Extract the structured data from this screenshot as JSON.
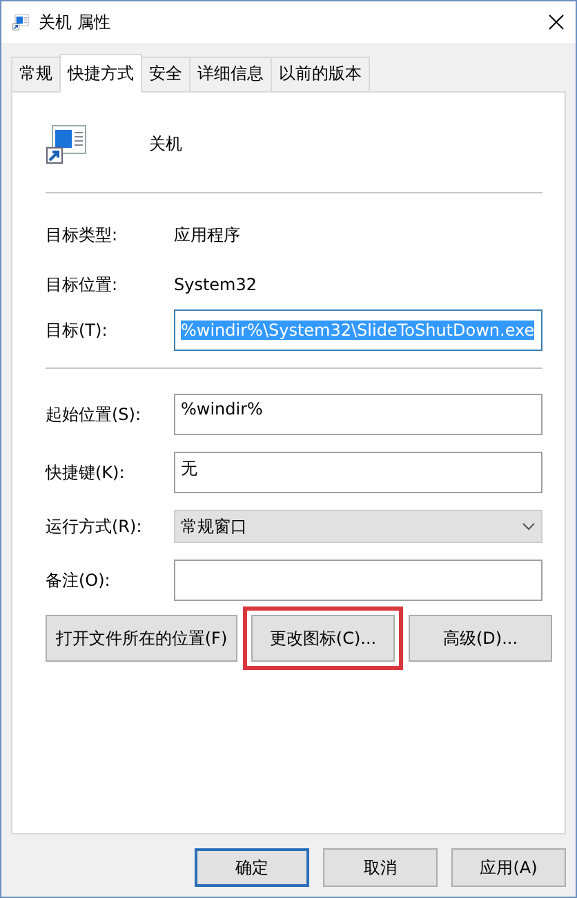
{
  "window": {
    "title": "关机 属性"
  },
  "tabs": [
    {
      "label": "常规",
      "selected": false
    },
    {
      "label": "快捷方式",
      "selected": true
    },
    {
      "label": "安全",
      "selected": false
    },
    {
      "label": "详细信息",
      "selected": false
    },
    {
      "label": "以前的版本",
      "selected": false
    }
  ],
  "shortcut": {
    "name": "关机"
  },
  "info": [
    {
      "label": "目标类型:",
      "value": "应用程序"
    },
    {
      "label": "目标位置:",
      "value": "System32"
    }
  ],
  "target": {
    "label": "目标(T):",
    "value": "%windir%\\System32\\SlideToShutDown.exe",
    "selected": true
  },
  "fields": [
    {
      "kind": "text",
      "label": "起始位置(S):",
      "value": "%windir%"
    },
    {
      "kind": "text",
      "label": "快捷键(K):",
      "value": "无"
    },
    {
      "kind": "dropdown",
      "label": "运行方式(R):",
      "value": "常规窗口"
    },
    {
      "kind": "text",
      "label": "备注(O):"
    }
  ],
  "actions": [
    {
      "label": "打开文件所在的位置(F)",
      "highlighted": false
    },
    {
      "label": "更改图标(C)...",
      "highlighted": true
    },
    {
      "label": "高级(D)...",
      "highlighted": false
    }
  ],
  "dialog_buttons": [
    {
      "label": "确定",
      "default": true
    },
    {
      "label": "取消",
      "default": false
    },
    {
      "label": "应用(A)",
      "default": false
    }
  ]
}
